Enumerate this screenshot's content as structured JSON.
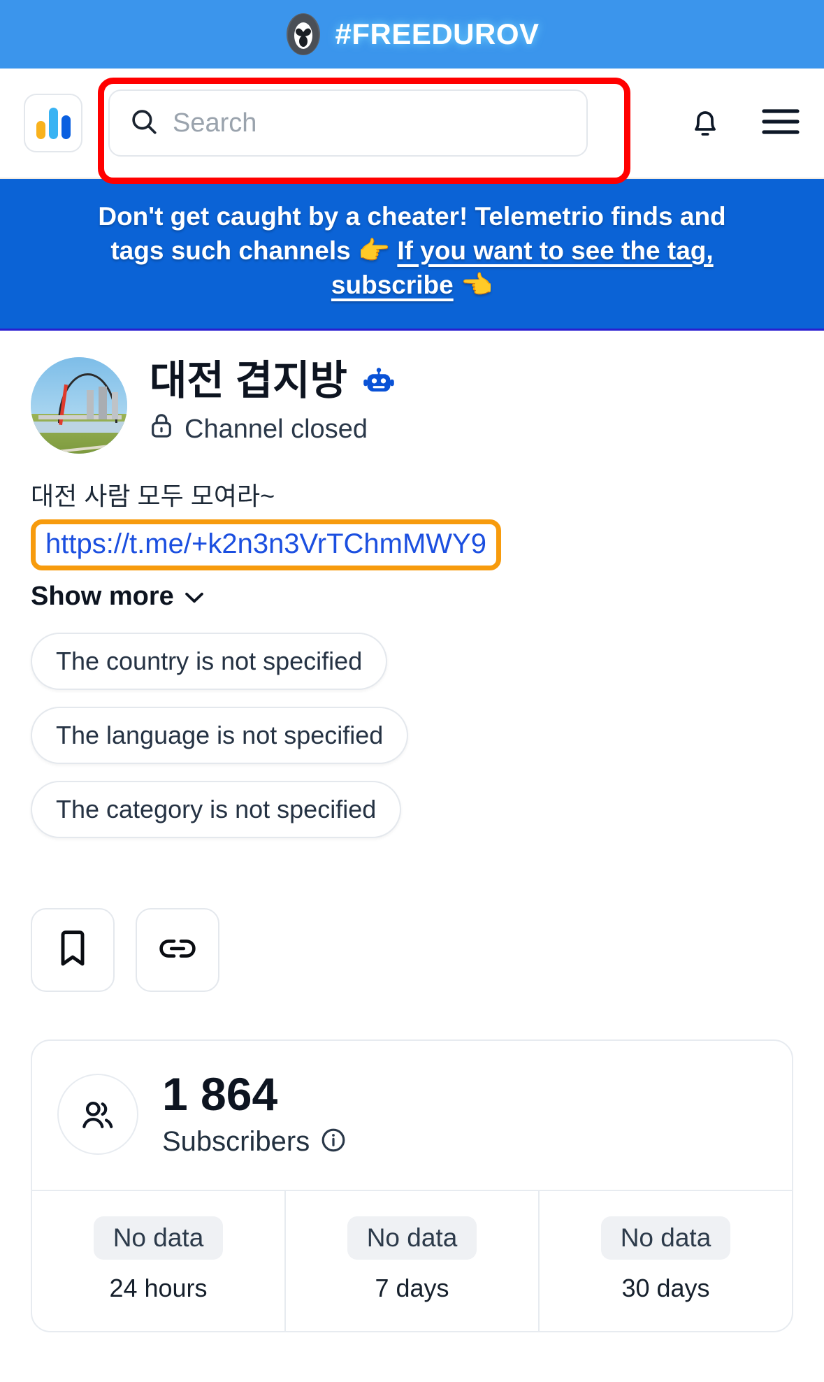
{
  "promo": {
    "text": "#FREEDUROV",
    "logo_icon": "durov-penguin-icon"
  },
  "header": {
    "logo_icon": "telemetrio-bars-logo",
    "search": {
      "placeholder": "Search",
      "value": "",
      "icon": "search-icon"
    },
    "bell_icon": "notification-bell-icon",
    "menu_icon": "hamburger-menu-icon",
    "highlight_color": "#ff0000"
  },
  "banner": {
    "line1": "Don't get caught by a cheater! Telemetrio finds and",
    "line2_prefix": "tags such channels ",
    "pointer_right": "👉",
    "link_part1": "If you want to see the tag,",
    "link_part2": "subscribe",
    "pointer_left": "👈",
    "background": "#0b63d6"
  },
  "channel": {
    "avatar_icon": "channel-avatar-bridge-photo",
    "title": "대전 겹지방",
    "verified_emoji": "🤖",
    "status_icon": "lock-icon",
    "status": "Channel closed",
    "description": "대전 사람 모두 모여라~",
    "link": "https://t.me/+k2n3n3VrTChmMWY9",
    "link_highlight_color": "#f79b0d",
    "show_more": "Show more",
    "chevron_icon": "chevron-down-icon",
    "chips": [
      "The country is not specified",
      "The language is not specified",
      "The category is not specified"
    ],
    "actions": [
      {
        "name": "bookmark-button",
        "icon": "bookmark-icon"
      },
      {
        "name": "copy-link-button",
        "icon": "link-icon"
      }
    ]
  },
  "stats": {
    "people_icon": "people-icon",
    "subscribers_count": "1 864",
    "subscribers_label": "Subscribers",
    "info_icon": "info-icon",
    "periods": [
      {
        "value": "No data",
        "period": "24 hours"
      },
      {
        "value": "No data",
        "period": "7 days"
      },
      {
        "value": "No data",
        "period": "30 days"
      }
    ]
  }
}
